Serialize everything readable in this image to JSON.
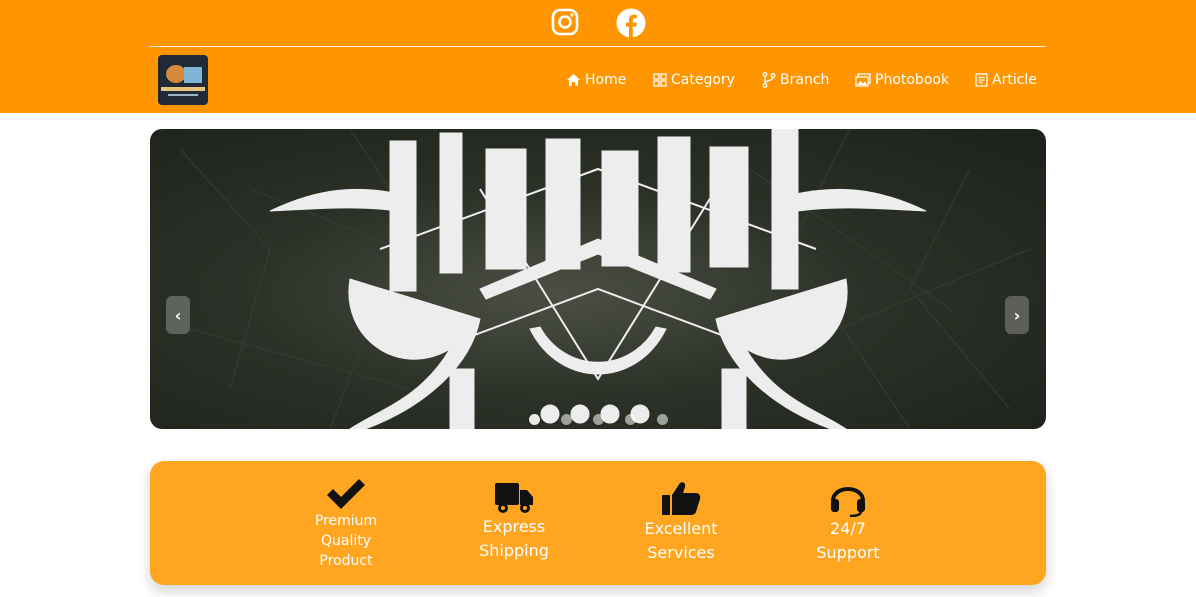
{
  "social": {
    "instagram_icon": "instagram-icon",
    "facebook_icon": "facebook-icon"
  },
  "logo": {
    "alt": "Logo"
  },
  "nav": {
    "items": [
      {
        "label": "Home",
        "icon": "home-icon"
      },
      {
        "label": "Category",
        "icon": "grid-icon"
      },
      {
        "label": "Branch",
        "icon": "branch-icon"
      },
      {
        "label": "Photobook",
        "icon": "photos-icon"
      },
      {
        "label": "Article",
        "icon": "document-icon"
      }
    ]
  },
  "hero": {
    "prev_label": "‹",
    "next_label": "›",
    "slide_count": 5,
    "active_slide": 0
  },
  "features": [
    {
      "lines": [
        "Premium",
        "Quality",
        "Product"
      ],
      "icon": "checkmark-icon"
    },
    {
      "lines": [
        "Express",
        "Shipping"
      ],
      "icon": "truck-icon"
    },
    {
      "lines": [
        "Excellent",
        "Services"
      ],
      "icon": "thumbs-up-icon"
    },
    {
      "lines": [
        "24/7",
        "Support"
      ],
      "icon": "headset-icon"
    }
  ],
  "colors": {
    "brand": "#ff9600",
    "features_bg": "#ffa520",
    "text": "#ffffff"
  }
}
